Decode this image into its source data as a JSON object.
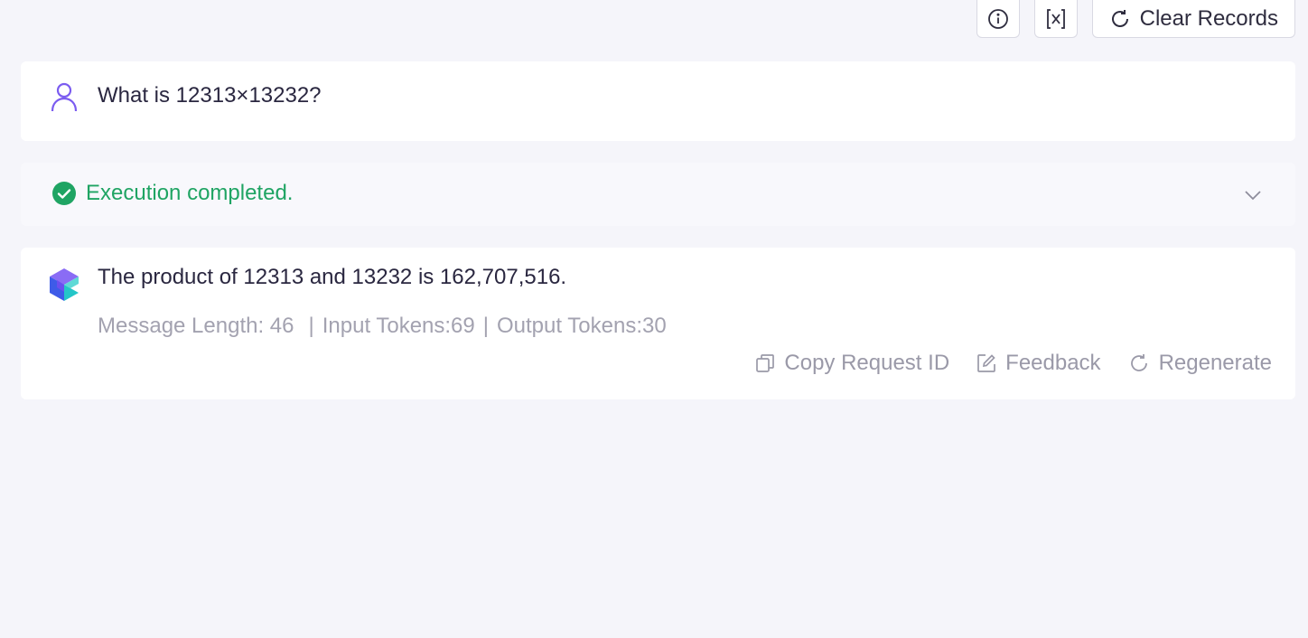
{
  "toolbar": {
    "info_icon": "info-circle",
    "variable_icon": "bracket-x",
    "clear_label": "Clear Records",
    "clear_icon": "refresh"
  },
  "user_message": {
    "text": "What is 12313×13232?",
    "avatar_icon": "user-outline",
    "accent_color": "#7b5cf0"
  },
  "execution": {
    "status": "Execution completed.",
    "status_color": "#1fa463"
  },
  "assistant_message": {
    "text": "The product of 12313 and 13232 is 162,707,516.",
    "meta": {
      "message_length": "Message Length: 46",
      "input_tokens": "Input Tokens:69",
      "output_tokens": "Output Tokens:30",
      "separator": "|"
    },
    "actions": {
      "copy_label": "Copy Request ID",
      "feedback_label": "Feedback",
      "regenerate_label": "Regenerate"
    }
  }
}
